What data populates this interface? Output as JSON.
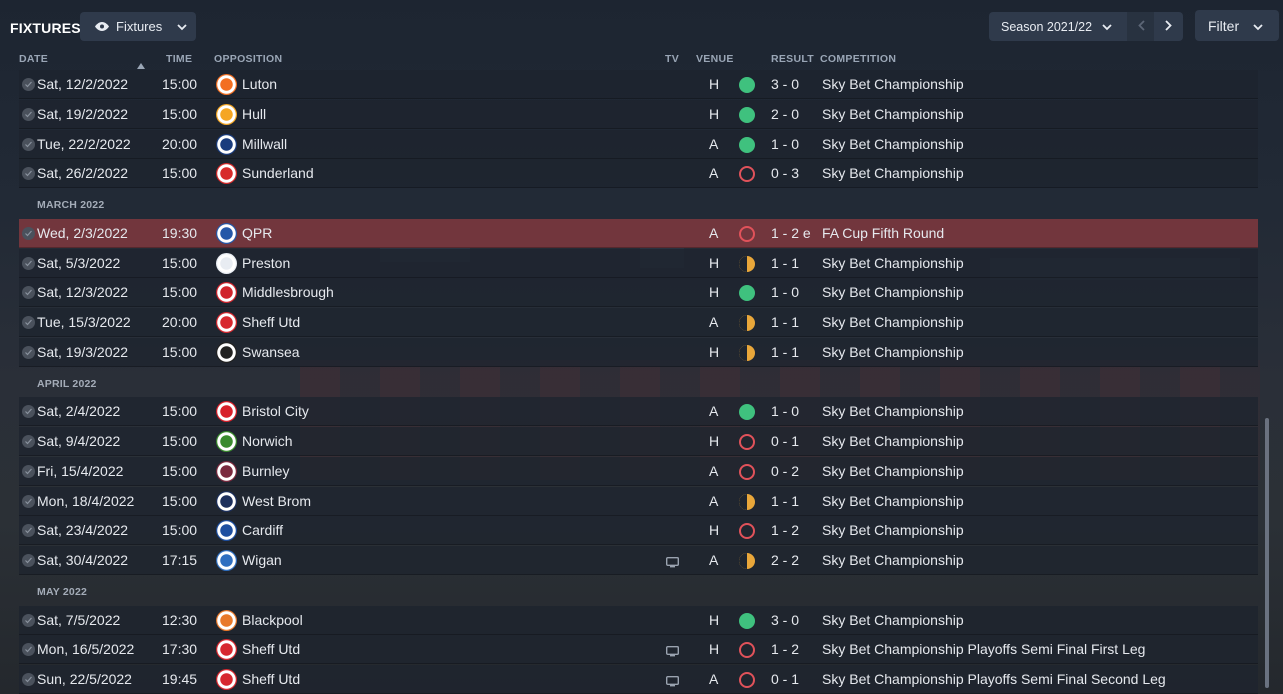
{
  "header": {
    "title": "FIXTURES",
    "view_label": "Fixtures",
    "season_label": "Season 2021/22",
    "filter_label": "Filter"
  },
  "columns": {
    "date": "DATE",
    "time": "TIME",
    "opposition": "OPPOSITION",
    "tv": "TV",
    "venue": "VENUE",
    "result": "RESULT",
    "competition": "COMPETITION"
  },
  "colors": {
    "win": "#3fc17e",
    "loss": "#e0525a",
    "draw": "#e9a73a",
    "highlight_row": "#80383e"
  },
  "months": [
    "MARCH 2022",
    "APRIL 2022",
    "MAY 2022"
  ],
  "fixtures": [
    {
      "date": "Sat, 12/2/2022",
      "time": "15:00",
      "opposition": "Luton",
      "tv": false,
      "venue": "H",
      "outcome": "win",
      "result": "3 - 0",
      "competition": "Sky Bet Championship",
      "crest": "#f36f21"
    },
    {
      "date": "Sat, 19/2/2022",
      "time": "15:00",
      "opposition": "Hull",
      "tv": false,
      "venue": "H",
      "outcome": "win",
      "result": "2 - 0",
      "competition": "Sky Bet Championship",
      "crest": "#f5a623"
    },
    {
      "date": "Tue, 22/2/2022",
      "time": "20:00",
      "opposition": "Millwall",
      "tv": false,
      "venue": "A",
      "outcome": "win",
      "result": "1 - 0",
      "competition": "Sky Bet Championship",
      "crest": "#1a3c7d"
    },
    {
      "date": "Sat, 26/2/2022",
      "time": "15:00",
      "opposition": "Sunderland",
      "tv": false,
      "venue": "A",
      "outcome": "loss",
      "result": "0 - 3",
      "competition": "Sky Bet Championship",
      "crest": "#d72a2a"
    },
    {
      "date": "Wed, 2/3/2022",
      "time": "19:30",
      "opposition": "QPR",
      "tv": false,
      "venue": "A",
      "outcome": "loss",
      "result": "1 - 2 e",
      "competition": "FA Cup Fifth Round",
      "crest": "#2458a8"
    },
    {
      "date": "Sat, 5/3/2022",
      "time": "15:00",
      "opposition": "Preston",
      "tv": false,
      "venue": "H",
      "outcome": "draw",
      "result": "1 - 1",
      "competition": "Sky Bet Championship",
      "crest": "#e8ecf2"
    },
    {
      "date": "Sat, 12/3/2022",
      "time": "15:00",
      "opposition": "Middlesbrough",
      "tv": false,
      "venue": "H",
      "outcome": "win",
      "result": "1 - 0",
      "competition": "Sky Bet Championship",
      "crest": "#d0242c"
    },
    {
      "date": "Tue, 15/3/2022",
      "time": "20:00",
      "opposition": "Sheff Utd",
      "tv": false,
      "venue": "A",
      "outcome": "draw",
      "result": "1 - 1",
      "competition": "Sky Bet Championship",
      "crest": "#d7282f"
    },
    {
      "date": "Sat, 19/3/2022",
      "time": "15:00",
      "opposition": "Swansea",
      "tv": false,
      "venue": "H",
      "outcome": "draw",
      "result": "1 - 1",
      "competition": "Sky Bet Championship",
      "crest": "#222222"
    },
    {
      "date": "Sat, 2/4/2022",
      "time": "15:00",
      "opposition": "Bristol City",
      "tv": false,
      "venue": "A",
      "outcome": "win",
      "result": "1 - 0",
      "competition": "Sky Bet Championship",
      "crest": "#d8202a"
    },
    {
      "date": "Sat, 9/4/2022",
      "time": "15:00",
      "opposition": "Norwich",
      "tv": false,
      "venue": "H",
      "outcome": "loss",
      "result": "0 - 1",
      "competition": "Sky Bet Championship",
      "crest": "#3a8b2e"
    },
    {
      "date": "Fri, 15/4/2022",
      "time": "15:00",
      "opposition": "Burnley",
      "tv": false,
      "venue": "A",
      "outcome": "loss",
      "result": "0 - 2",
      "competition": "Sky Bet Championship",
      "crest": "#7a2a3e"
    },
    {
      "date": "Mon, 18/4/2022",
      "time": "15:00",
      "opposition": "West Brom",
      "tv": false,
      "venue": "A",
      "outcome": "draw",
      "result": "1 - 1",
      "competition": "Sky Bet Championship",
      "crest": "#1c2f5c"
    },
    {
      "date": "Sat, 23/4/2022",
      "time": "15:00",
      "opposition": "Cardiff",
      "tv": false,
      "venue": "H",
      "outcome": "loss",
      "result": "1 - 2",
      "competition": "Sky Bet Championship",
      "crest": "#1e4fa0"
    },
    {
      "date": "Sat, 30/4/2022",
      "time": "17:15",
      "opposition": "Wigan",
      "tv": true,
      "venue": "A",
      "outcome": "draw",
      "result": "2 - 2",
      "competition": "Sky Bet Championship",
      "crest": "#2f6fc0"
    },
    {
      "date": "Sat, 7/5/2022",
      "time": "12:30",
      "opposition": "Blackpool",
      "tv": false,
      "venue": "H",
      "outcome": "win",
      "result": "3 - 0",
      "competition": "Sky Bet Championship",
      "crest": "#e8792a"
    },
    {
      "date": "Mon, 16/5/2022",
      "time": "17:30",
      "opposition": "Sheff Utd",
      "tv": true,
      "venue": "H",
      "outcome": "loss",
      "result": "1 - 2",
      "competition": "Sky Bet Championship Playoffs Semi Final First Leg",
      "crest": "#d7282f"
    },
    {
      "date": "Sun, 22/5/2022",
      "time": "19:45",
      "opposition": "Sheff Utd",
      "tv": true,
      "venue": "A",
      "outcome": "loss",
      "result": "0 - 1",
      "competition": "Sky Bet Championship Playoffs Semi Final Second Leg",
      "crest": "#d7282f"
    }
  ]
}
